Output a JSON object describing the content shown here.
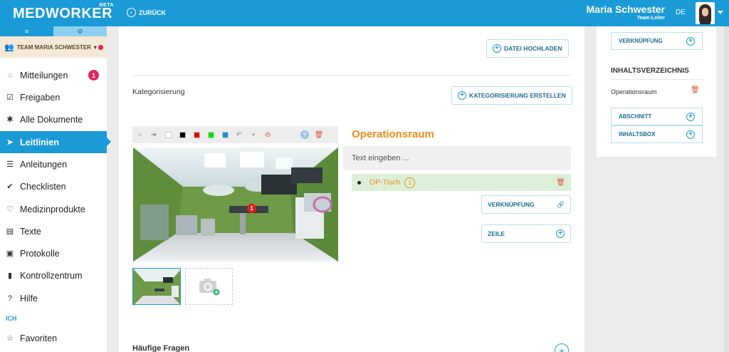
{
  "header": {
    "logo": "MEDWORKER",
    "beta": "BETA",
    "back_label": "ZURÜCK",
    "user_name": "Maria Schwester",
    "user_role": "Team-Leiter",
    "language": "DE"
  },
  "sidebar": {
    "tab_list_icon": "≡",
    "tab_settings_icon": "⚙",
    "team": "TEAM MARIA SCHWESTER",
    "items": [
      {
        "label": "Mitteilungen",
        "icon": "chat-icon",
        "glyph": "◌",
        "badge": "1"
      },
      {
        "label": "Freigaben",
        "icon": "checkbox-icon",
        "glyph": "☑"
      },
      {
        "label": "Alle Dokumente",
        "icon": "asterisk-icon",
        "glyph": "✱"
      },
      {
        "label": "Leitlinien",
        "icon": "send-icon",
        "glyph": "➤",
        "active": true
      },
      {
        "label": "Anleitungen",
        "icon": "list-icon",
        "glyph": "☰"
      },
      {
        "label": "Checklisten",
        "icon": "check-circle-icon",
        "glyph": "✔"
      },
      {
        "label": "Medizinprodukte",
        "icon": "heartbeat-icon",
        "glyph": "♡"
      },
      {
        "label": "Texte",
        "icon": "document-icon",
        "glyph": "▤"
      },
      {
        "label": "Protokolle",
        "icon": "clipboard-icon",
        "glyph": "▣"
      },
      {
        "label": "Kontrollzentrum",
        "icon": "bar-chart-icon",
        "glyph": "▮"
      },
      {
        "label": "Hilfe",
        "icon": "help-icon",
        "glyph": "?"
      }
    ],
    "section_ich": "ICH",
    "favorites": {
      "label": "Favoriten",
      "icon": "star-icon",
      "glyph": "☆"
    }
  },
  "main": {
    "upload_button": "DATEI HOCHLADEN",
    "categorization_label": "Kategorisierung",
    "create_category_button": "KATEGORISIERUNG ERSTELLEN",
    "toolbar_colors": [
      "#ffffff",
      "#000000",
      "#e00000",
      "#00e000",
      "#1a8fd0"
    ],
    "section_title": "Operationsraum",
    "text_placeholder": "Text eingeben ...",
    "bullet": {
      "text": "OP-Tisch",
      "count": "1"
    },
    "marker_number": "1",
    "link_button": "VERKNÜPFUNG",
    "row_button": "ZEILE",
    "faq_label": "Häufige Fragen"
  },
  "right_panel": {
    "link_button": "VERKNÜPFUNG",
    "toc_title": "INHALTSVERZEICHNIS",
    "toc_items": [
      "Operationsraum"
    ],
    "section_button": "ABSCHNITT",
    "infobox_button": "INHALTSBOX"
  },
  "colors": {
    "primary": "#1a9ad6",
    "accent_orange": "#ee8a18",
    "danger": "#e0245e",
    "highlight_green": "#dcefd7"
  }
}
